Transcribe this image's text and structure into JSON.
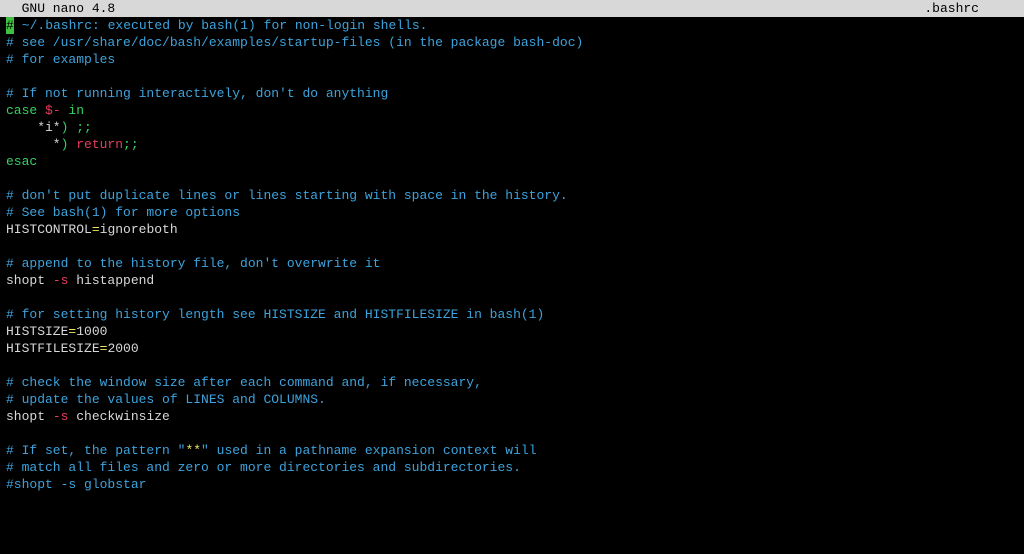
{
  "titlebar": {
    "app_label": "  GNU nano 4.8",
    "filename": ".bashrc     "
  },
  "lines": {
    "l01_seg2": " ~/.bashrc: executed by bash(1) for non-login shells.",
    "l02": "# see /usr/share/doc/bash/examples/startup-files (in the package bash-doc)",
    "l03": "# for examples",
    "l04": "",
    "l05": "# If not running interactively, don't do anything",
    "l06_case": "case",
    "l06_var": " $-",
    "l06_in": " in",
    "l07_pat": "    *i*",
    "l07_rest": ") ;;",
    "l08_pat": "      *",
    "l08_paren": ") ",
    "l08_ret": "return",
    "l08_semi": ";;",
    "l09": "esac",
    "l10": "",
    "l11": "# don't put duplicate lines or lines starting with space in the history.",
    "l12": "# See bash(1) for more options",
    "l13_var": "HISTCONTROL",
    "l13_eq": "=",
    "l13_val": "ignoreboth",
    "l14": "",
    "l15": "# append to the history file, don't overwrite it",
    "l16_cmd": "shopt ",
    "l16_flag": "-s",
    "l16_arg": " histappend",
    "l17": "",
    "l18": "# for setting history length see HISTSIZE and HISTFILESIZE in bash(1)",
    "l19_var": "HISTSIZE",
    "l19_eq": "=",
    "l19_val": "1000",
    "l20_var": "HISTFILESIZE",
    "l20_eq": "=",
    "l20_val": "2000",
    "l21": "",
    "l22": "# check the window size after each command and, if necessary,",
    "l23": "# update the values of LINES and COLUMNS.",
    "l24_cmd": "shopt ",
    "l24_flag": "-s",
    "l24_arg": " checkwinsize",
    "l25": "",
    "l26a": "# If set, the pattern \"",
    "l26b": "**",
    "l26c": "\" used in a pathname expansion context will",
    "l27": "# match all files and zero or more directories and subdirectories.",
    "l28": "#shopt -s globstar"
  },
  "cursor_char": "#"
}
